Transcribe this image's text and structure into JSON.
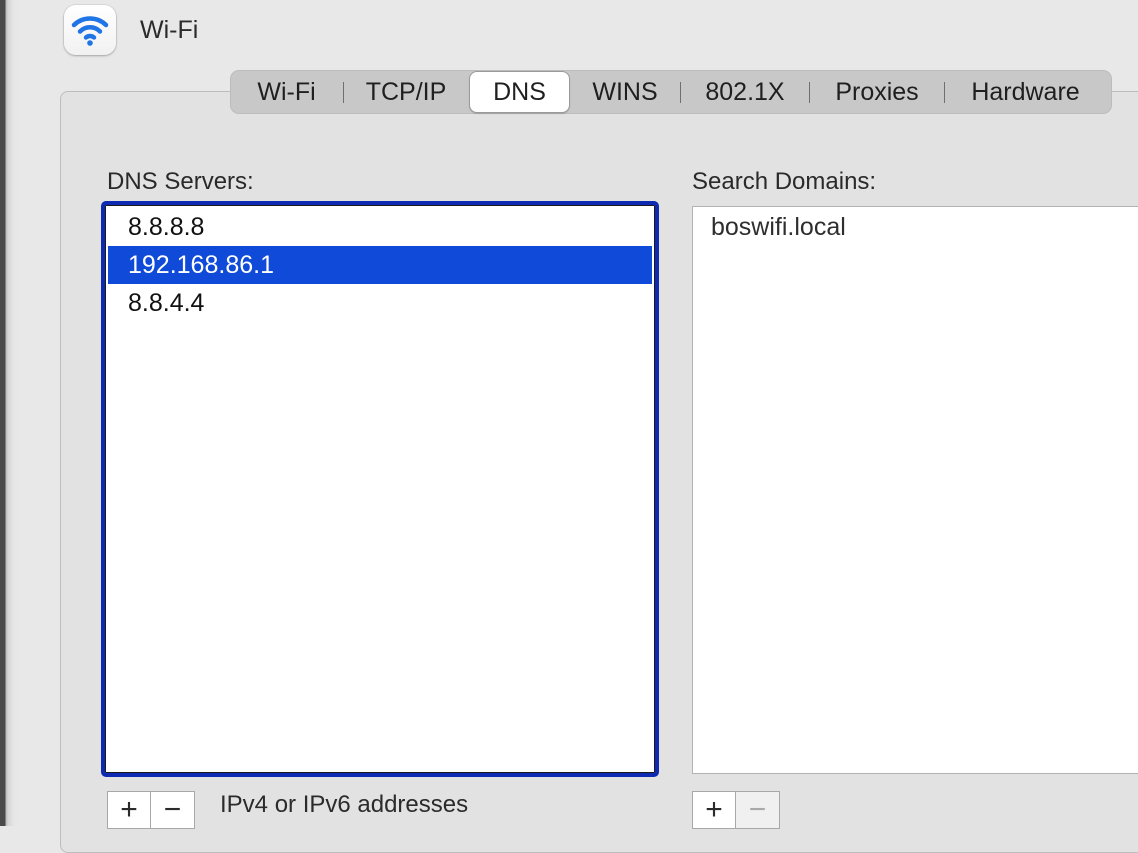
{
  "window": {
    "title": "Wi-Fi",
    "icon": "wifi-icon",
    "accent_color": "#1f74e6"
  },
  "tabs": [
    {
      "label": "Wi-Fi",
      "selected": false
    },
    {
      "label": "TCP/IP",
      "selected": false
    },
    {
      "label": "DNS",
      "selected": true
    },
    {
      "label": "WINS",
      "selected": false
    },
    {
      "label": "802.1X",
      "selected": false
    },
    {
      "label": "Proxies",
      "selected": false
    },
    {
      "label": "Hardware",
      "selected": false
    }
  ],
  "dns": {
    "label": "DNS Servers:",
    "servers": [
      "8.8.8.8",
      "192.168.86.1",
      "8.8.4.4"
    ],
    "selected_server": "192.168.86.1",
    "add_label": "+",
    "remove_label": "−",
    "hint": "IPv4 or IPv6 addresses",
    "focus_color": "#0e2ab2",
    "selection_color": "#0f4bd8"
  },
  "search": {
    "label": "Search Domains:",
    "domains": [
      "boswifi.local"
    ],
    "add_label": "+",
    "remove_label": "−"
  }
}
